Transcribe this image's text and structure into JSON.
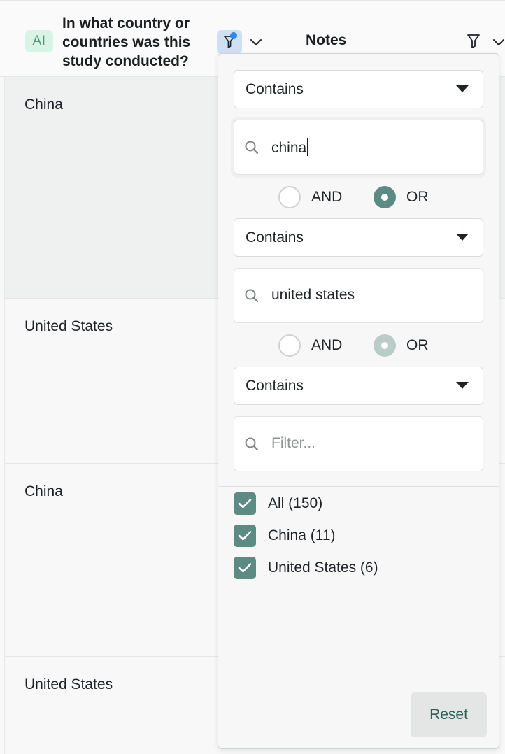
{
  "header": {
    "ai_badge": "AI",
    "column_title": "In what country or countries was this study conducted?",
    "notes_title": "Notes"
  },
  "rows": [
    {
      "country": "China"
    },
    {
      "country": "United States"
    },
    {
      "country": "China"
    },
    {
      "country": "United States"
    }
  ],
  "filter_popup": {
    "conditions": [
      {
        "operator": "Contains",
        "value": "china",
        "placeholder": ""
      },
      {
        "operator": "Contains",
        "value": "united states",
        "placeholder": ""
      },
      {
        "operator": "Contains",
        "value": "",
        "placeholder": "Filter..."
      }
    ],
    "joins": [
      {
        "and_label": "AND",
        "or_label": "OR",
        "selected": "OR"
      },
      {
        "and_label": "AND",
        "or_label": "OR",
        "selected": "OR"
      }
    ],
    "values": [
      {
        "label": "All (150)",
        "checked": true
      },
      {
        "label": "China (11)",
        "checked": true
      },
      {
        "label": "United States (6)",
        "checked": true
      }
    ],
    "reset_label": "Reset"
  },
  "colors": {
    "accent": "#5b8b82",
    "ai_badge_bg": "#d9f3e4",
    "filter_active_bg": "#cfe0f3",
    "filter_dot": "#2f86f0"
  },
  "icons": {
    "column_filter": "funnel-icon",
    "column_menu": "chevron-down-icon",
    "search": "search-icon",
    "check": "checkmark-icon"
  }
}
